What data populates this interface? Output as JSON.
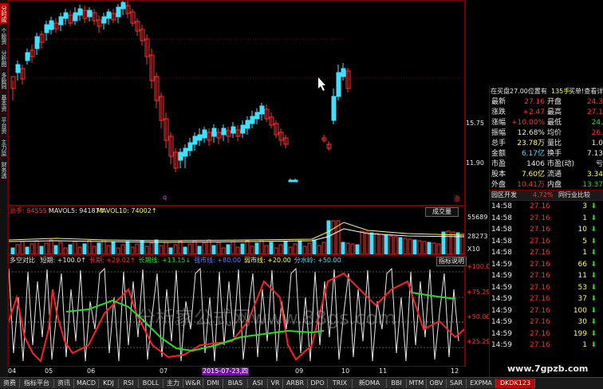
{
  "sidebar": {
    "tabs": [
      "分时成交",
      "个股资料",
      "分析图表",
      "多股同列",
      "基本资料",
      "平台资讯",
      "主力监控",
      "财务透视"
    ]
  },
  "main_chart": {
    "price_labels": [
      "15.75",
      "11.90"
    ],
    "marker_q": "q",
    "marker_end": "涨",
    "colors": {
      "up": "#ff3030",
      "down": "#40e0ff"
    }
  },
  "volume_panel": {
    "total_label": "总手: 94555↑",
    "mavol5_label": "MAVOL5: 94187↑",
    "mavol10_label": "MAVOL10: 74002↑",
    "dropdown": "成交量",
    "scale": [
      "55689",
      "28273",
      "X10"
    ]
  },
  "indicator_panel": {
    "name": "多空对比",
    "params": [
      {
        "text": "短期: +100.0↑",
        "color": "white"
      },
      {
        "text": "长期: +29.02↑",
        "color": "red"
      },
      {
        "text": "长期线: +13.15↓",
        "color": "green"
      },
      {
        "text": "强市线: +80.00",
        "color": "blue"
      },
      {
        "text": "弱市线: +20.00",
        "color": "yellow"
      },
      {
        "text": "分水岭: +50.00",
        "color": "cyan"
      }
    ],
    "explain_button": "指标说明",
    "scale": [
      "+100.0",
      "+75.29",
      "+50.00",
      "+25.29"
    ]
  },
  "x_axis": {
    "months": [
      "04",
      "05",
      "06",
      "07",
      "09",
      "10",
      "11",
      "12"
    ],
    "highlight_date": "2015-07-23,四"
  },
  "quote_header": {
    "left": "在买盘27.00位置有",
    "mid": "135手",
    "right": "买单!查看详情"
  },
  "quote": [
    {
      "l1": "最新",
      "v1": "27.16",
      "l2": "开盘",
      "v2": "24.3",
      "c1": "red",
      "c2": "red"
    },
    {
      "l1": "涨跌",
      "v1": "+2.47",
      "l2": "最高",
      "v2": "27.1",
      "c1": "red",
      "c2": "red"
    },
    {
      "l1": "涨幅",
      "v1": "+10.00%",
      "l2": "最低",
      "v2": "24.",
      "c1": "red",
      "c2": "green"
    },
    {
      "l1": "振幅",
      "v1": "12.68%",
      "l2": "均价",
      "v2": "26.",
      "c1": "white",
      "c2": "red"
    },
    {
      "l1": "总手",
      "v1": "23.78万",
      "l2": "量比",
      "v2": "1.0",
      "c1": "yellow",
      "c2": "white"
    },
    {
      "l1": "金额",
      "v1": "6.17亿",
      "l2": "换手",
      "v2": "7.13",
      "c1": "cyan",
      "c2": "white"
    },
    {
      "l1": "市盈",
      "v1": "1406",
      "l2": "市盈(动)",
      "v2": "亏",
      "c1": "white",
      "c2": "white"
    },
    {
      "l1": "股本",
      "v1": "7.60亿",
      "l2": "流通",
      "v2": "3.34",
      "c1": "yellow",
      "c2": "yellow"
    },
    {
      "l1": "外盘",
      "v1": "10.41万",
      "l2": "内盘",
      "v2": "13.37",
      "c1": "red",
      "c2": "green"
    }
  ],
  "sector": {
    "name": "园区开发",
    "pct": "4.72%",
    "compare": "同行业比较"
  },
  "ticks": [
    {
      "time": "14:58",
      "price": "27.16",
      "vol": "3",
      "dir": "down"
    },
    {
      "time": "14:58",
      "price": "27.16",
      "vol": "1",
      "dir": "down"
    },
    {
      "time": "14:58",
      "price": "27.16",
      "vol": "10",
      "dir": "down"
    },
    {
      "time": "14:58",
      "price": "27.16",
      "vol": "5",
      "dir": "down"
    },
    {
      "time": "14:58",
      "price": "27.16",
      "vol": "1",
      "dir": "down"
    },
    {
      "time": "14:59",
      "price": "27.16",
      "vol": "66",
      "dir": "down"
    },
    {
      "time": "14:59",
      "price": "27.16",
      "vol": "11",
      "dir": "down"
    },
    {
      "time": "14:59",
      "price": "27.16",
      "vol": "53",
      "dir": "down"
    },
    {
      "time": "14:59",
      "price": "27.16",
      "vol": "37",
      "dir": "down"
    },
    {
      "time": "14:59",
      "price": "27.16",
      "vol": "100",
      "dir": "down"
    },
    {
      "time": "14:59",
      "price": "27.16",
      "vol": "30",
      "dir": "down"
    },
    {
      "time": "14:59",
      "price": "27.16",
      "vol": "199",
      "dir": "down"
    },
    {
      "time": "14:59",
      "price": "27.16",
      "vol": "1",
      "dir": "down"
    }
  ],
  "bottom_tabs": [
    "资费",
    "指标平台",
    "资讯",
    "MACD",
    "KDJ",
    "RSI",
    "BOLL",
    "主力",
    "W&R",
    "DMI",
    "BIAS",
    "ASI",
    "VR",
    "ARBR",
    "DPO",
    "TRIX",
    "新DMA",
    "BBI",
    "MTM",
    "OBV",
    "SAR",
    "EXPMA",
    "DKDK123"
  ],
  "active_tab": "DKDK123",
  "watermark": "分析家公式网www.88gs.com",
  "watermark2": "www.7gpzb.com"
}
